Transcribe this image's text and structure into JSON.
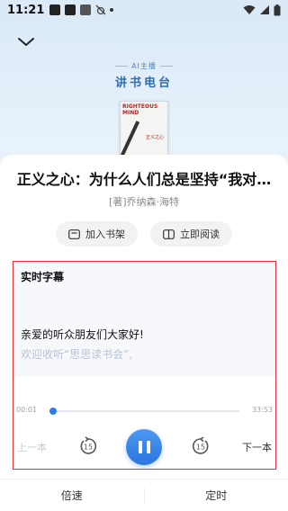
{
  "status_bar": {
    "time": "11:21",
    "icons": [
      "notification-icon",
      "app-icon",
      "app-icon",
      "bug-icon",
      "dot-icon",
      "wifi-icon",
      "signal-icon",
      "battery-icon"
    ]
  },
  "header": {
    "back_icon": "chevron-down-icon",
    "brand_sub": "AI主播",
    "brand_main": "讲书电台"
  },
  "book": {
    "cover_title": "RIGHTEOUS MIND",
    "cover_cn": "正义之心",
    "title": "正义之心：为什么人们总是坚持“我对…",
    "author": "[著]乔纳森·海特"
  },
  "actions": {
    "add_shelf": "加入书架",
    "read_now": "立即阅读"
  },
  "subtitles": {
    "heading": "实时字幕",
    "line1": "亲爱的听众朋友们大家好!",
    "line2": "欢迎收听“思思读书会”,"
  },
  "player": {
    "current_time": "00:01",
    "total_time": "33:53",
    "progress": 0.02,
    "prev_label": "上一本",
    "next_label": "下一本",
    "skip_back_seconds": "15",
    "skip_fwd_seconds": "15"
  },
  "bottom": {
    "speed_label": "倍速",
    "timer_label": "定时"
  },
  "colors": {
    "accent": "#2f7be8",
    "highlight_border": "#e03030",
    "hero_bg": "#dceaf8"
  }
}
